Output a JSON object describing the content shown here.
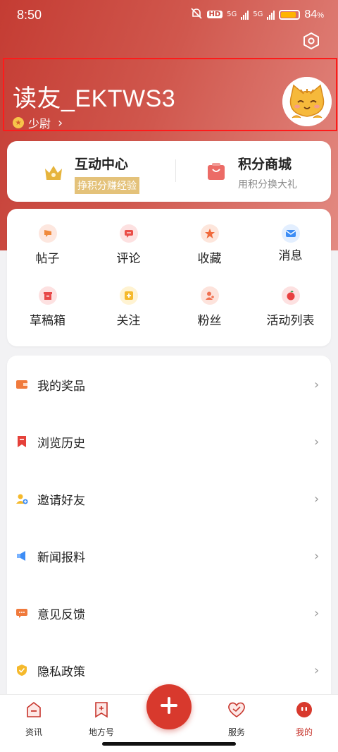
{
  "status_bar": {
    "time": "8:50",
    "network_1": "5G",
    "network_2": "5G",
    "hd_label": "HD",
    "battery_percent": "84",
    "battery_suffix": "%",
    "battery_level": 0.84
  },
  "profile": {
    "username": "读友_EKTWS3",
    "rank": "少尉"
  },
  "top_card": {
    "left_title": "互动中心",
    "left_badge": "挣积分赚经验",
    "right_title": "积分商城",
    "right_sub": "用积分换大礼"
  },
  "grid": {
    "items": [
      {
        "label": "帖子",
        "icon": "post-icon"
      },
      {
        "label": "评论",
        "icon": "comment-icon"
      },
      {
        "label": "收藏",
        "icon": "favorite-icon"
      },
      {
        "label": "消息",
        "icon": "message-icon"
      },
      {
        "label": "草稿箱",
        "icon": "drafts-icon"
      },
      {
        "label": "关注",
        "icon": "follow-icon"
      },
      {
        "label": "粉丝",
        "icon": "fans-icon"
      },
      {
        "label": "活动列表",
        "icon": "activity-list-icon"
      }
    ]
  },
  "list": {
    "items": [
      {
        "label": "我的奖品",
        "icon": "wallet-icon"
      },
      {
        "label": "浏览历史",
        "icon": "bookmark-icon"
      },
      {
        "label": "邀请好友",
        "icon": "invite-user-icon"
      },
      {
        "label": "新闻报料",
        "icon": "megaphone-icon"
      },
      {
        "label": "意见反馈",
        "icon": "feedback-icon"
      },
      {
        "label": "隐私政策",
        "icon": "shield-icon"
      }
    ]
  },
  "bottom_nav": {
    "items": [
      {
        "label": "资讯",
        "icon": "news-icon"
      },
      {
        "label": "地方号",
        "icon": "local-account-icon"
      },
      {
        "label": "服务",
        "icon": "service-icon"
      },
      {
        "label": "我的",
        "icon": "profile-icon",
        "active": true
      }
    ],
    "fab_icon": "plus-icon"
  },
  "colors": {
    "brand": "#d8392d",
    "accent_gold": "#e4c27a",
    "highlight_border": "#ff1a1a"
  }
}
